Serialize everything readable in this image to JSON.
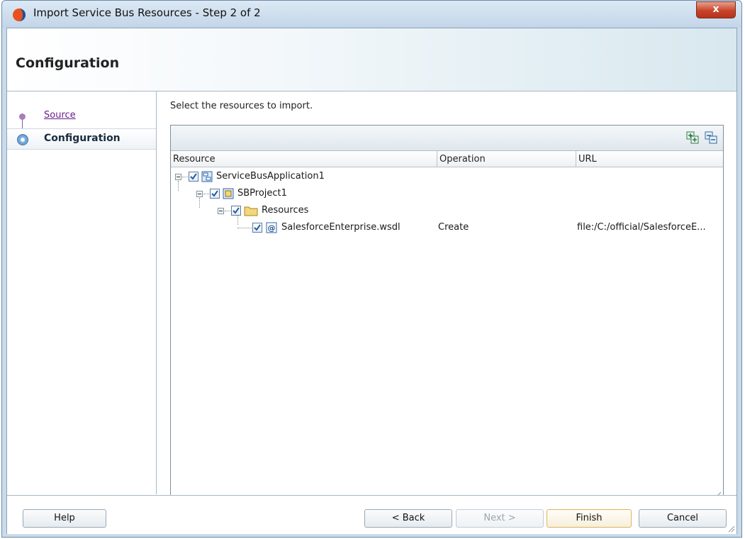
{
  "window": {
    "title": "Import Service Bus Resources - Step 2 of 2",
    "close_label": "x"
  },
  "header": {
    "heading": "Configuration"
  },
  "nav": {
    "items": [
      {
        "label": "Source",
        "state": "visited"
      },
      {
        "label": "Configuration",
        "state": "current"
      }
    ]
  },
  "main": {
    "instruction": "Select the resources to import.",
    "table": {
      "columns": [
        "Resource",
        "Operation",
        "URL"
      ],
      "rows": [
        {
          "resource": "ServiceBusApplication1",
          "icon": "application-icon",
          "checked": true,
          "operation": "",
          "url": ""
        },
        {
          "resource": "SBProject1",
          "icon": "project-icon",
          "checked": true,
          "operation": "",
          "url": ""
        },
        {
          "resource": "Resources",
          "icon": "folder-icon",
          "checked": true,
          "operation": "",
          "url": ""
        },
        {
          "resource": "SalesforceEnterprise.wsdl",
          "icon": "wsdl-icon",
          "checked": true,
          "operation": "Create",
          "url": "file:/C:/official/SalesforceE..."
        }
      ]
    }
  },
  "footer": {
    "help": "Help",
    "back": "< Back",
    "next": "Next >",
    "finish": "Finish",
    "cancel": "Cancel"
  },
  "colors": {
    "title_bar": "#c9dbeb",
    "visited_link": "#6a1e8a",
    "close_button": "#c8432a",
    "finish_border": "#e0b45a"
  }
}
